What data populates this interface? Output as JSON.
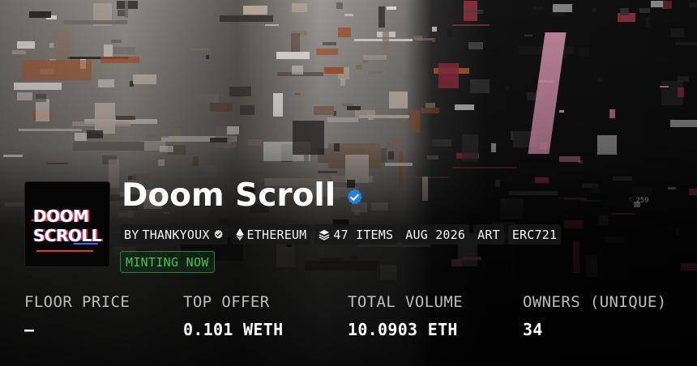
{
  "collection": {
    "name": "Doom Scroll",
    "avatar_text": [
      "DOOM",
      "SCROLL"
    ],
    "creator_prefix": "BY",
    "creator": "THANKYOUX",
    "chain": "ETHEREUM",
    "items": "47 ITEMS",
    "date": "AUG 2026",
    "category": "ART",
    "standard": "ERC721",
    "status": "MINTING NOW"
  },
  "stats": [
    {
      "label": "FLOOR PRICE",
      "value": "—"
    },
    {
      "label": "TOP OFFER",
      "value": "0.101 WETH"
    },
    {
      "label": "TOTAL VOLUME",
      "value": "10.0903 ETH"
    },
    {
      "label": "OWNERS (UNIQUE)",
      "value": "34"
    }
  ],
  "banner_overlay": {
    "likes": "259"
  },
  "colors": {
    "verified": "#2081e2",
    "status_green": "#49c05e",
    "glitch_red": "#e0323f",
    "glitch_pink": "#e88aa8"
  },
  "icons": {
    "verified": "verified-badge-icon",
    "chain": "ethereum-icon",
    "items": "layers-icon"
  }
}
